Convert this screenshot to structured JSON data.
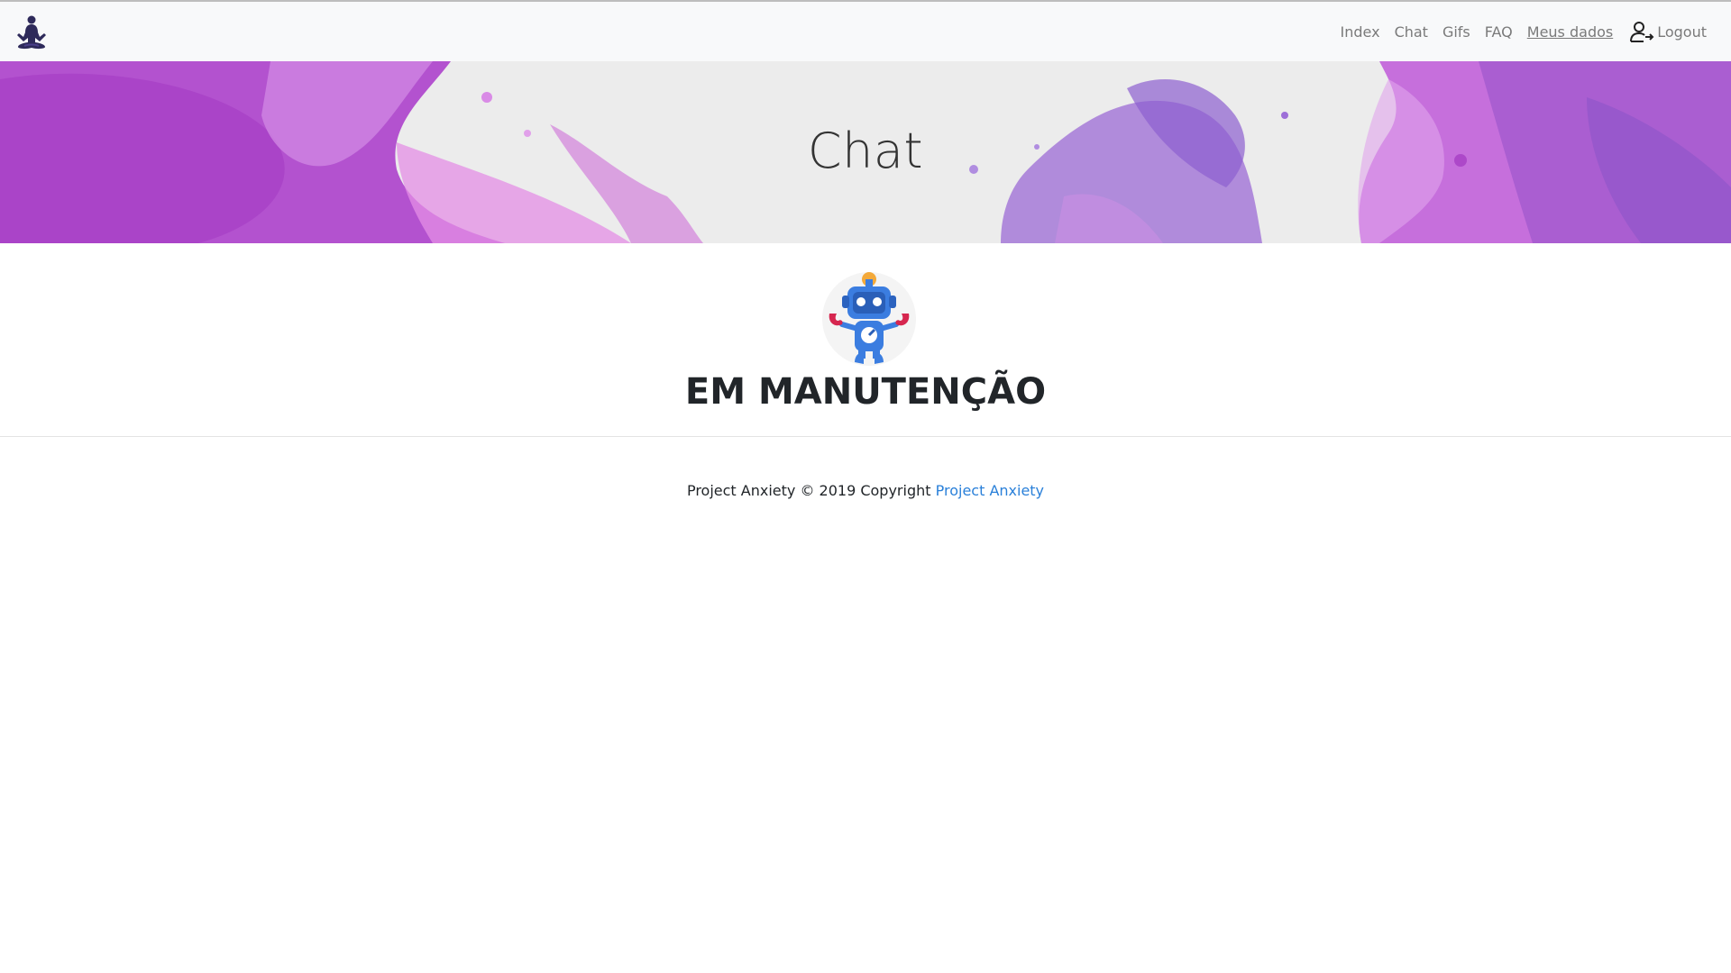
{
  "nav": {
    "items": [
      {
        "label": "Index"
      },
      {
        "label": "Chat"
      },
      {
        "label": "Gifs"
      },
      {
        "label": "FAQ"
      },
      {
        "label": "Meus dados"
      }
    ],
    "logout_label": "Logout",
    "brand_icon": "meditation-figure-icon",
    "logout_icon": "user-logout-icon"
  },
  "hero": {
    "title": "Chat",
    "palette": [
      "#b04fd0",
      "#d887e6",
      "#9a62d6",
      "#e7b6ee"
    ]
  },
  "main": {
    "illustration": "robot-icon",
    "heading": "EM MANUTENÇÃO"
  },
  "footer": {
    "text": "Project Anxiety © 2019 Copyright ",
    "link_label": "Project Anxiety",
    "link_color": "#2a80d9"
  }
}
